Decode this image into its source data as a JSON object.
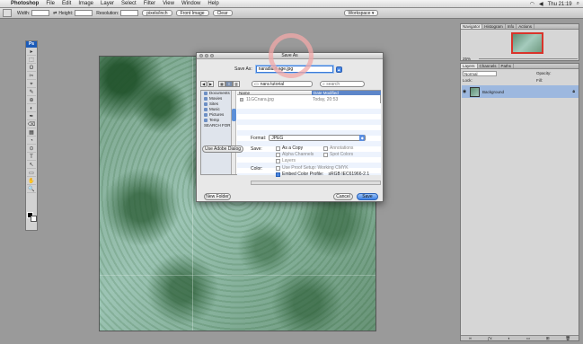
{
  "menubar": {
    "apple": "",
    "app_name": "Photoshop",
    "items": [
      "File",
      "Edit",
      "Image",
      "Layer",
      "Select",
      "Filter",
      "View",
      "Window",
      "Help"
    ],
    "clock": "Thu 21:19"
  },
  "options_bar": {
    "width_label": "Width:",
    "height_label": "Height:",
    "resolution_label": "Resolution:",
    "resolution_unit": "pixels/inch",
    "front_image": "Front Image",
    "clear": "Clear",
    "workspace": "Workspace ▾"
  },
  "toolbox": {
    "logo": "Ps",
    "tools": [
      "▸",
      "⬚",
      "ʘ",
      "✂",
      "⌖",
      "✎",
      "⊕",
      "◐",
      "✒",
      "⌫",
      "▦",
      "◔",
      "⊙",
      "T",
      "↖",
      "▭",
      "✋",
      "🔍"
    ]
  },
  "dialog": {
    "title": "Save As",
    "save_as_label": "Save As:",
    "filename": "naradiaimage.jpg",
    "location": "nara tutorial",
    "search_placeholder": "search",
    "sidebar": [
      "Documents",
      "Movies",
      "Sites",
      "Music",
      "Pictures",
      "Temp",
      "SEARCH FOR"
    ],
    "columns": {
      "name": "Name",
      "date": "Date Modified"
    },
    "files": [
      {
        "name": "11GCnara.jpg",
        "date": "Today, 20:53"
      }
    ],
    "format_label": "Format:",
    "format_value": "JPEG",
    "use_adobe_dialog": "Use Adobe Dialog",
    "save_label": "Save:",
    "save_options": {
      "as_a_copy": "As a Copy",
      "alpha_channels": "Alpha Channels",
      "layers": "Layers",
      "annotations": "Annotations",
      "spot_colors": "Spot Colors"
    },
    "color_label": "Color:",
    "proof_setup": "Use Proof Setup:  Working CMYK",
    "embed_profile": "Embed Color Profile:",
    "profile_name": "sRGB IEC61966-2.1",
    "new_folder": "New Folder",
    "cancel": "Cancel",
    "save": "Save"
  },
  "navigator": {
    "tabs": [
      "Navigator",
      "Histogram",
      "Info",
      "Actions"
    ],
    "zoom": "25%"
  },
  "layers": {
    "tabs": [
      "Layers",
      "Channels",
      "Paths"
    ],
    "blend_mode": "Normal",
    "opacity_label": "Opacity:",
    "lock_label": "Lock:",
    "fill_label": "Fill:",
    "layer_name": "Background",
    "footer_icons": [
      "∞",
      "ƒx",
      "◐",
      "▭",
      "⊞",
      "🗑"
    ]
  }
}
